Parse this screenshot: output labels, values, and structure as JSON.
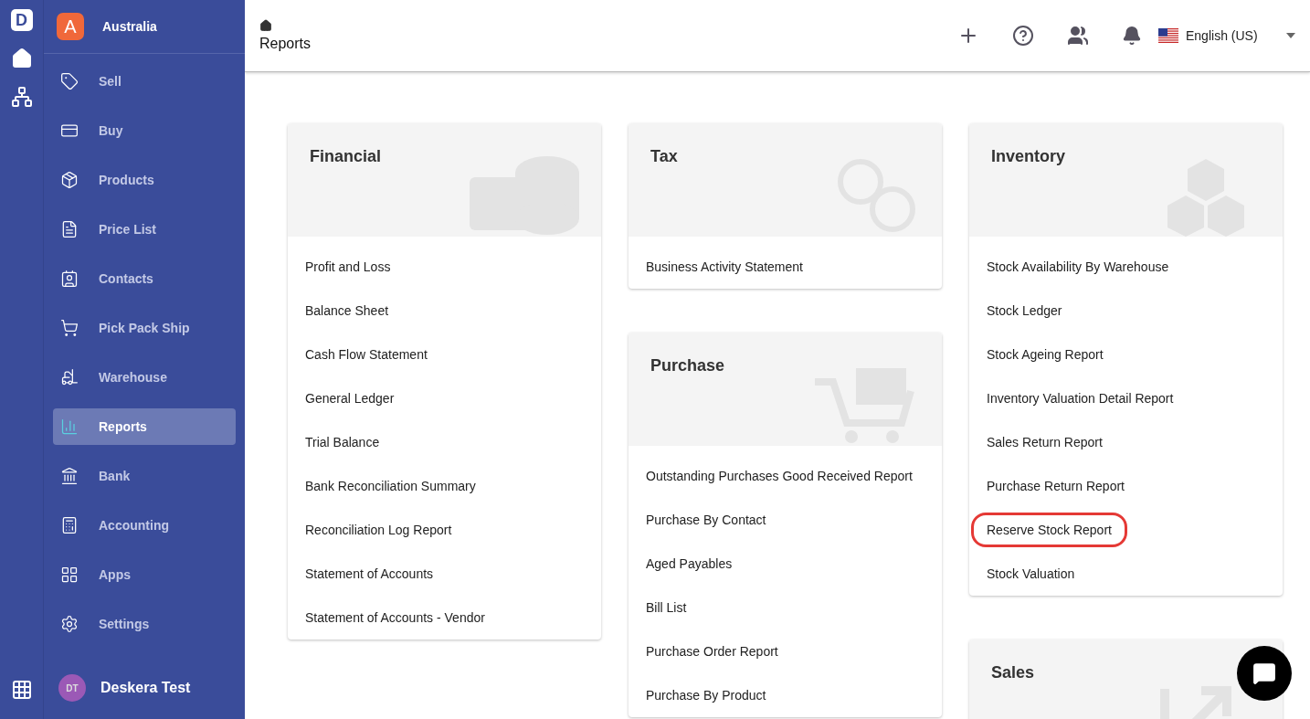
{
  "rail": {
    "logo": "D"
  },
  "org": {
    "initial": "A",
    "name": "Australia"
  },
  "sidebar": {
    "items": [
      {
        "label": "Sell",
        "selected": false
      },
      {
        "label": "Buy",
        "selected": false
      },
      {
        "label": "Products",
        "selected": false
      },
      {
        "label": "Price List",
        "selected": false
      },
      {
        "label": "Contacts",
        "selected": false
      },
      {
        "label": "Pick Pack Ship",
        "selected": false
      },
      {
        "label": "Warehouse",
        "selected": false
      },
      {
        "label": "Reports",
        "selected": true
      },
      {
        "label": "Bank",
        "selected": false
      },
      {
        "label": "Accounting",
        "selected": false
      },
      {
        "label": "Apps",
        "selected": false
      },
      {
        "label": "Settings",
        "selected": false
      }
    ]
  },
  "user": {
    "initials": "DT",
    "name": "Deskera Test"
  },
  "header": {
    "title": "Reports",
    "language": "English (US)"
  },
  "columns": [
    [
      {
        "title": "Financial",
        "kind": "financial",
        "items": [
          {
            "label": "Profit and Loss",
            "highlighted": false
          },
          {
            "label": "Balance Sheet",
            "highlighted": false
          },
          {
            "label": "Cash Flow Statement",
            "highlighted": false
          },
          {
            "label": "General Ledger",
            "highlighted": false
          },
          {
            "label": "Trial Balance",
            "highlighted": false
          },
          {
            "label": "Bank Reconciliation Summary",
            "highlighted": false
          },
          {
            "label": "Reconciliation Log Report",
            "highlighted": false
          },
          {
            "label": "Statement of Accounts",
            "highlighted": false
          },
          {
            "label": "Statement of Accounts - Vendor",
            "highlighted": false
          }
        ]
      }
    ],
    [
      {
        "title": "Tax",
        "kind": "tax",
        "items": [
          {
            "label": "Business Activity Statement",
            "highlighted": false
          }
        ]
      },
      {
        "title": "Purchase",
        "kind": "purchase",
        "items": [
          {
            "label": "Outstanding Purchases Good Received Report",
            "highlighted": false
          },
          {
            "label": "Purchase By Contact",
            "highlighted": false
          },
          {
            "label": "Aged Payables",
            "highlighted": false
          },
          {
            "label": "Bill List",
            "highlighted": false
          },
          {
            "label": "Purchase Order Report",
            "highlighted": false
          },
          {
            "label": "Purchase By Product",
            "highlighted": false
          }
        ]
      }
    ],
    [
      {
        "title": "Inventory",
        "kind": "inventory",
        "items": [
          {
            "label": "Stock Availability By Warehouse",
            "highlighted": false
          },
          {
            "label": "Stock Ledger",
            "highlighted": false
          },
          {
            "label": "Stock Ageing Report",
            "highlighted": false
          },
          {
            "label": "Inventory Valuation Detail Report",
            "highlighted": false
          },
          {
            "label": "Sales Return Report",
            "highlighted": false
          },
          {
            "label": "Purchase Return Report",
            "highlighted": false
          },
          {
            "label": "Reserve Stock Report",
            "highlighted": true
          },
          {
            "label": "Stock Valuation",
            "highlighted": false
          }
        ]
      },
      {
        "title": "Sales",
        "kind": "sales"
      }
    ]
  ]
}
